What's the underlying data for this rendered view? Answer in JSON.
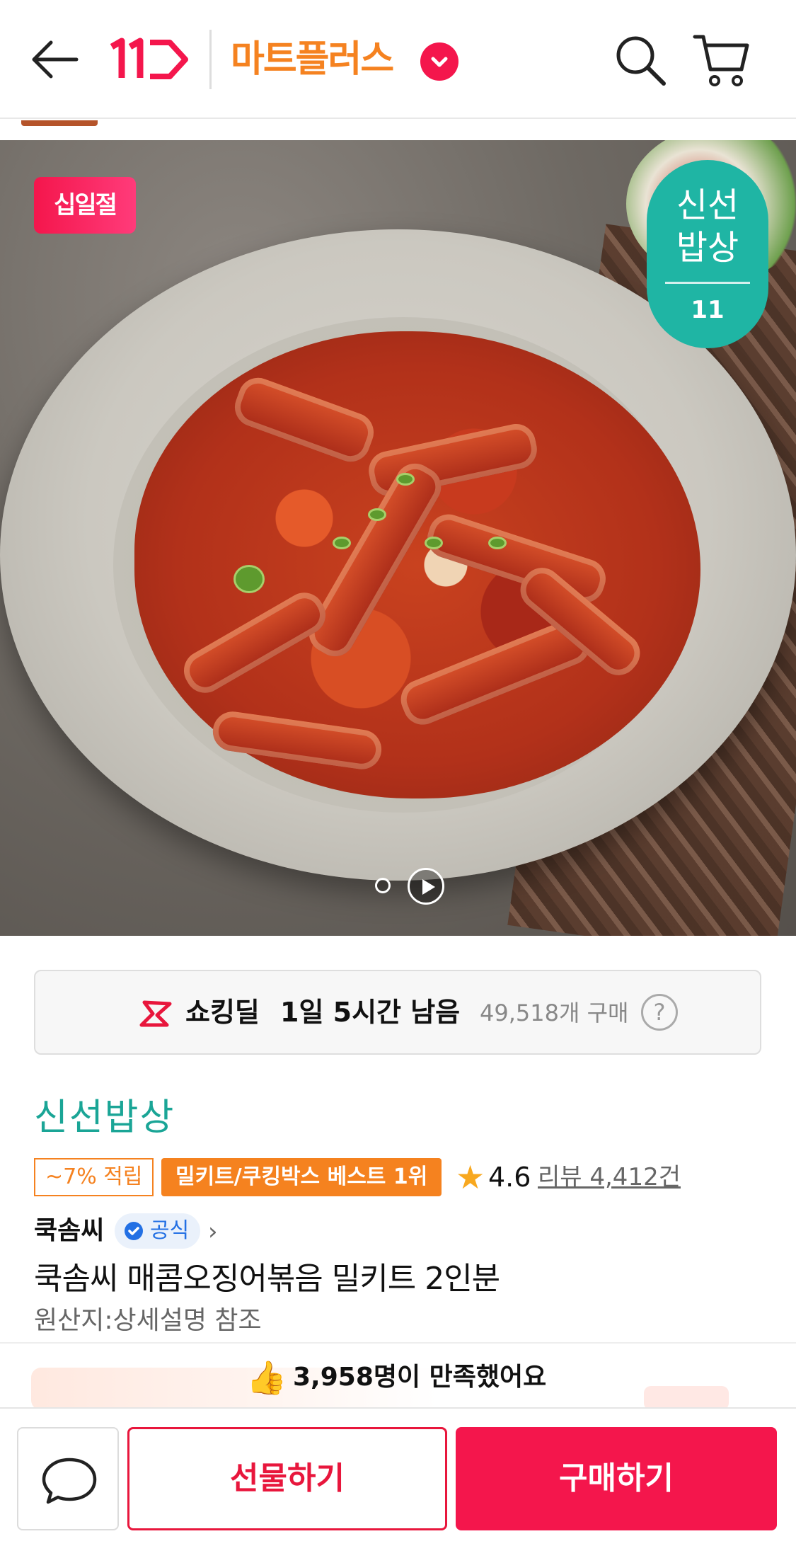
{
  "header": {
    "logo_text": "11",
    "mart_label": "마트플러스"
  },
  "hero": {
    "event_badge": "십일절",
    "brand_badge": {
      "line1": "신선",
      "line2": "밥상",
      "line3": "11"
    }
  },
  "deal": {
    "name": "쇼킹딜",
    "time_left": "1일 5시간 남음",
    "purchase_count": "49,518개 구매",
    "help_label": "?"
  },
  "product": {
    "brand": "신선밥상",
    "points_tag": "~7% 적립",
    "best_tag": "밀키트/쿠킹박스 베스트 1위",
    "rating": "4.6",
    "reviews": "리뷰 4,412건",
    "seller": "쿡솜씨",
    "official_label": "공식",
    "title": "쿡솜씨 매콤오징어볶음 밀키트 2인분",
    "origin": "원산지:상세설명 참조"
  },
  "satisfaction": {
    "icon": "👍",
    "text": "3,958명이 만족했어요"
  },
  "actions": {
    "gift_label": "선물하기",
    "buy_label": "구매하기"
  },
  "colors": {
    "accent_red": "#f4164c",
    "mart_orange": "#f58220",
    "brand_teal": "#1aa596"
  }
}
